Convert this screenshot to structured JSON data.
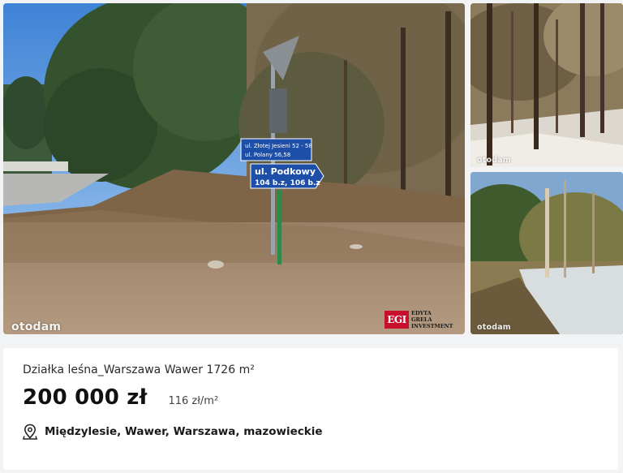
{
  "gallery": {
    "watermark": "otodam",
    "agency_logo": {
      "mark": "EGI",
      "name": "EDYTA GRELA INVESTMENT"
    },
    "sign": {
      "top_line_1": "ul. Złotej Jesieni 52 - 58",
      "top_line_2": "ul. Polany 56,58",
      "bottom_line_1": "ul. Podkowy",
      "bottom_line_2": "104 b.z, 106 b.z"
    }
  },
  "listing": {
    "title": "Działka leśna_Warszawa Wawer 1726 m²",
    "price": "200 000 zł",
    "price_per_m2": "116 zł/m²",
    "location": "Międzylesie, Wawer, Warszawa, mazowieckie",
    "location_icon": "map-pin-icon"
  },
  "colors": {
    "background": "#f2f3f5",
    "card": "#ffffff",
    "sign_blue": "#1e4fa8",
    "agency_red": "#c8102e"
  }
}
